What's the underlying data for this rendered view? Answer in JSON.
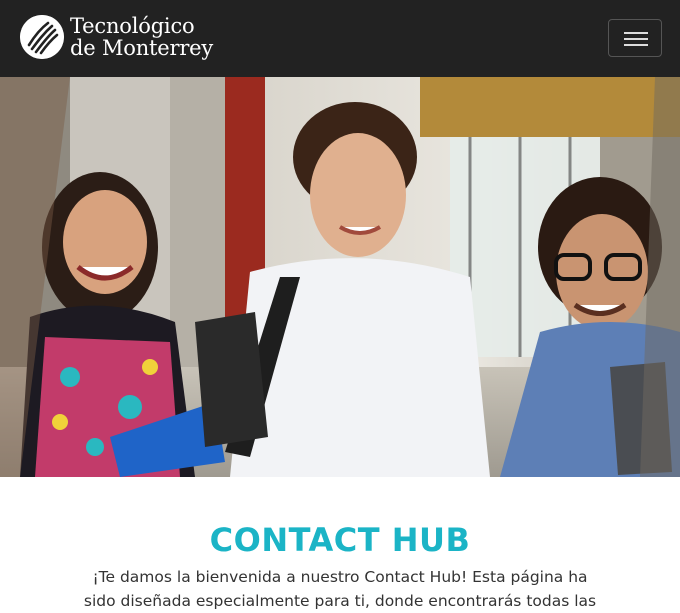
{
  "header": {
    "brand": {
      "line1": "Tecnológico",
      "line2": "de Monterrey",
      "logo_icon": "tec-monterrey-logo-icon"
    },
    "menu_toggle_icon": "hamburger-menu-icon"
  },
  "hero": {
    "image": "photo of three smiling students walking in a campus building"
  },
  "main": {
    "title": "CONTACT HUB",
    "intro": "¡Te damos la bienvenida a nuestro Contact Hub! Esta página ha sido diseñada especialmente para ti, donde encontrarás todas las"
  },
  "colors": {
    "navbar_bg": "#222222",
    "title": "#1bb4c6",
    "body_text": "#333333"
  }
}
